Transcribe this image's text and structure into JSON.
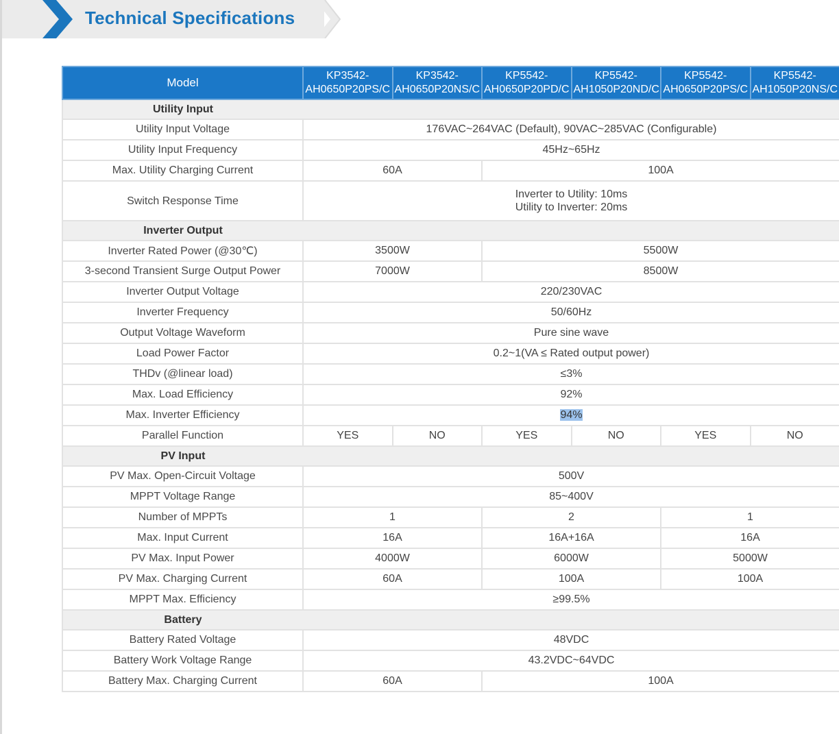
{
  "title": "Technical Specifications",
  "header": {
    "model_label": "Model",
    "models": [
      [
        "KP3542-",
        "AH0650P20PS/C"
      ],
      [
        "KP3542-",
        "AH0650P20NS/C"
      ],
      [
        "KP5542-",
        "AH0650P20PD/C"
      ],
      [
        "KP5542-",
        "AH1050P20ND/C"
      ],
      [
        "KP5542-",
        "AH0650P20PS/C"
      ],
      [
        "KP5542-",
        "AH1050P20NS/C"
      ]
    ]
  },
  "rows": [
    {
      "section": "Utility Input"
    },
    {
      "label": "Utility Input Voltage",
      "cells": [
        {
          "v": "176VAC~264VAC (Default), 90VAC~285VAC (Configurable)",
          "span": 6
        }
      ]
    },
    {
      "label": "Utility Input Frequency",
      "cells": [
        {
          "v": "45Hz~65Hz",
          "span": 6
        }
      ]
    },
    {
      "label": "Max. Utility Charging Current",
      "cells": [
        {
          "v": "60A",
          "span": 2
        },
        {
          "v": "100A",
          "span": 4
        }
      ]
    },
    {
      "label": "Switch Response Time",
      "tall": true,
      "cells": [
        {
          "v": "Inverter to Utility: 10ms",
          "v2": "Utility to Inverter: 20ms",
          "span": 6
        }
      ]
    },
    {
      "section": "Inverter Output"
    },
    {
      "label": "Inverter Rated Power (@30℃)",
      "cells": [
        {
          "v": "3500W",
          "span": 2
        },
        {
          "v": "5500W",
          "span": 4
        }
      ]
    },
    {
      "label": "3-second Transient Surge Output Power",
      "cells": [
        {
          "v": "7000W",
          "span": 2
        },
        {
          "v": "8500W",
          "span": 4
        }
      ]
    },
    {
      "label": "Inverter Output Voltage",
      "cells": [
        {
          "v": "220/230VAC",
          "span": 6
        }
      ]
    },
    {
      "label": "Inverter Frequency",
      "cells": [
        {
          "v": "50/60Hz",
          "span": 6
        }
      ]
    },
    {
      "label": "Output Voltage Waveform",
      "cells": [
        {
          "v": "Pure sine wave",
          "span": 6
        }
      ]
    },
    {
      "label": "Load Power Factor",
      "cells": [
        {
          "v": "0.2~1(VA ≤ Rated output power)",
          "span": 6
        }
      ]
    },
    {
      "label": "THDv (@linear load)",
      "cells": [
        {
          "v": "≤3%",
          "span": 6
        }
      ]
    },
    {
      "label": "Max. Load Efficiency",
      "cells": [
        {
          "v": "92%",
          "span": 6
        }
      ]
    },
    {
      "label": "Max. Inverter Efficiency",
      "cells": [
        {
          "v": "94%",
          "span": 6,
          "selected": true
        }
      ]
    },
    {
      "label": "Parallel Function",
      "cells": [
        {
          "v": "YES",
          "span": 1
        },
        {
          "v": "NO",
          "span": 1
        },
        {
          "v": "YES",
          "span": 1
        },
        {
          "v": "NO",
          "span": 1
        },
        {
          "v": "YES",
          "span": 1
        },
        {
          "v": "NO",
          "span": 1
        }
      ]
    },
    {
      "section": "PV Input"
    },
    {
      "label": "PV Max. Open-Circuit Voltage",
      "cells": [
        {
          "v": "500V",
          "span": 6
        }
      ]
    },
    {
      "label": "MPPT Voltage Range",
      "cells": [
        {
          "v": "85~400V",
          "span": 6
        }
      ]
    },
    {
      "label": "Number of MPPTs",
      "cells": [
        {
          "v": "1",
          "span": 2
        },
        {
          "v": "2",
          "span": 2
        },
        {
          "v": "1",
          "span": 2
        }
      ]
    },
    {
      "label": "Max. Input Current",
      "cells": [
        {
          "v": "16A",
          "span": 2
        },
        {
          "v": "16A+16A",
          "span": 2
        },
        {
          "v": "16A",
          "span": 2
        }
      ]
    },
    {
      "label": "PV Max. Input Power",
      "cells": [
        {
          "v": "4000W",
          "span": 2
        },
        {
          "v": "6000W",
          "span": 2
        },
        {
          "v": "5000W",
          "span": 2
        }
      ]
    },
    {
      "label": "PV Max. Charging Current",
      "cells": [
        {
          "v": "60A",
          "span": 2
        },
        {
          "v": "100A",
          "span": 2
        },
        {
          "v": "100A",
          "span": 2
        }
      ]
    },
    {
      "label": "MPPT Max. Efficiency",
      "cells": [
        {
          "v": "≥99.5%",
          "span": 6
        }
      ]
    },
    {
      "section": "Battery"
    },
    {
      "label": "Battery Rated Voltage",
      "cells": [
        {
          "v": "48VDC",
          "span": 6
        }
      ]
    },
    {
      "label": "Battery Work Voltage Range",
      "cells": [
        {
          "v": "43.2VDC~64VDC",
          "span": 6
        }
      ]
    },
    {
      "label": "Battery Max. Charging Current",
      "cells": [
        {
          "v": "60A",
          "span": 2
        },
        {
          "v": "100A",
          "span": 4
        }
      ]
    }
  ],
  "colors": {
    "accent": "#1b78c8",
    "title": "#1b76bd",
    "section_bg": "#efefef"
  }
}
